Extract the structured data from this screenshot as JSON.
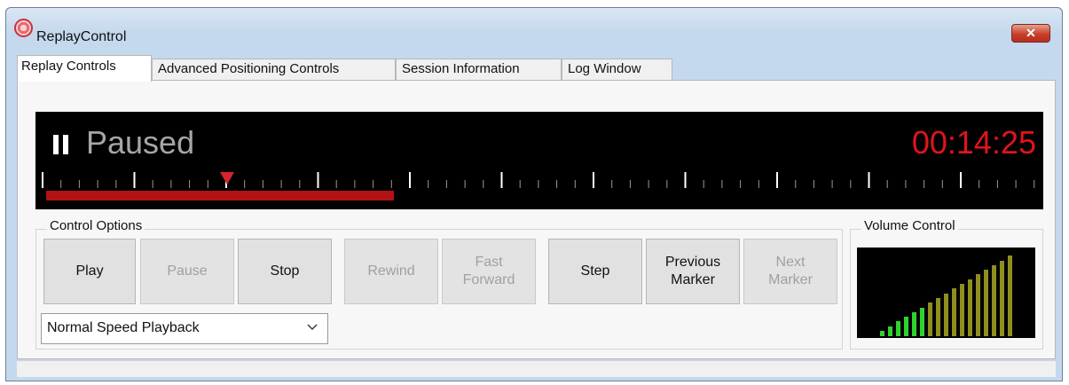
{
  "window": {
    "title": "ReplayControl",
    "close_label": "✕"
  },
  "tabs": [
    {
      "label": "Replay Controls",
      "active": true
    },
    {
      "label": "Advanced Positioning Controls",
      "active": false
    },
    {
      "label": "Session Information",
      "active": false
    },
    {
      "label": "Log Window",
      "active": false
    }
  ],
  "display": {
    "status": "Paused",
    "time": "00:14:25",
    "progress_fraction": 0.345,
    "colors": {
      "background": "#000000",
      "status": "#a6a6a6",
      "time": "#e0141c",
      "progress": "#b11313"
    }
  },
  "control_options": {
    "label": "Control Options",
    "buttons": {
      "play": {
        "label": "Play",
        "enabled": true
      },
      "pause": {
        "label": "Pause",
        "enabled": false
      },
      "stop": {
        "label": "Stop",
        "enabled": true
      },
      "rewind": {
        "label": "Rewind",
        "enabled": false
      },
      "fast_forward": {
        "label": "Fast Forward",
        "enabled": false
      },
      "step": {
        "label": "Step",
        "enabled": true
      },
      "previous_marker": {
        "label": "Previous Marker",
        "enabled": true
      },
      "next_marker": {
        "label": "Next Marker",
        "enabled": false
      }
    },
    "speed_select": {
      "value": "Normal Speed Playback"
    }
  },
  "volume": {
    "label": "Volume Control",
    "bars_total": 17,
    "bars_green": 6,
    "colors": {
      "green": "#2fd32f",
      "olive": "#8f8f1f"
    }
  }
}
